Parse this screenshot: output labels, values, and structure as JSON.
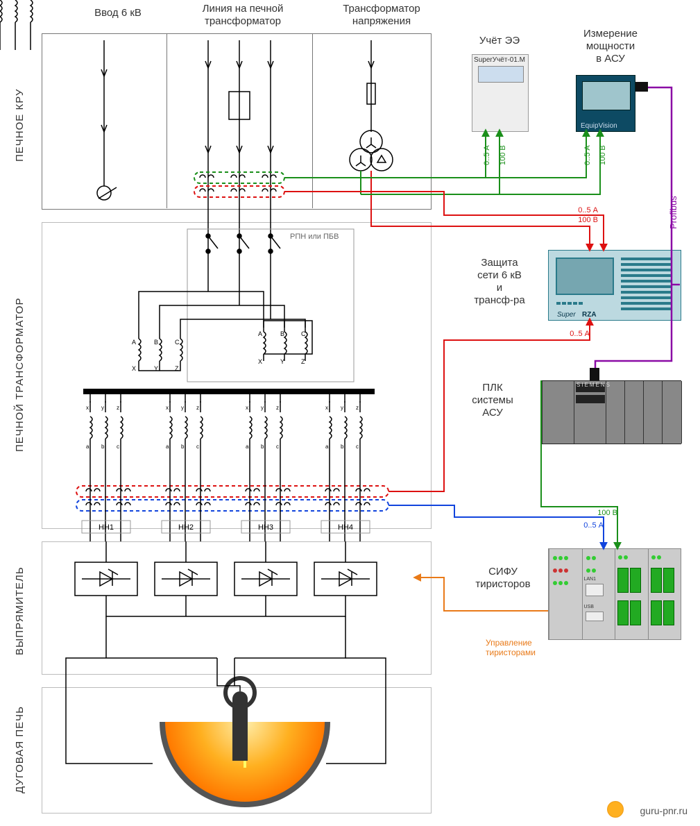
{
  "columns": {
    "input6kv": "Ввод 6 кВ",
    "line_to_ft": "Линия на печной\nтрансформатор",
    "voltage_trans": "Трансформатор\nнапряжения"
  },
  "rows": {
    "kru": "ПЕЧНОЕ КРУ",
    "ft": "ПЕЧНОЙ ТРАНСФОРМАТОР",
    "rect": "ВЫПРЯМИТЕЛЬ",
    "arc": "ДУГОВАЯ ПЕЧЬ"
  },
  "devices": {
    "meter_title": "Учёт ЭЭ",
    "meter_model": "SuperУчёт-01.M",
    "power_title": "Измерение\nмощности\nв АСУ",
    "power_vendor": "EquipVision",
    "rza_title": "Защита\nсети 6 кВ\nи\nтрансф-ра",
    "rza_brand1": "Super",
    "rza_brand2": "RZA",
    "plc_title": "ПЛК\nсистемы\nАСУ",
    "plc_brand": "SIEMENS",
    "sifu_title": "СИФУ\nтиристоров",
    "sifu_port1": "LAN1",
    "sifu_port2": "USB"
  },
  "signals": {
    "meter_amp": "0..5 А",
    "meter_volt": "100 В",
    "power_amp": "0..5 А",
    "power_volt": "100 В",
    "rza1_amp": "0..5 А",
    "rza1_volt": "100 В",
    "rza2_amp": "0..5 А",
    "sifu_volt": "100 В",
    "sifu_amp": "0..5 А",
    "profibus": "Profibus",
    "thyristor_ctrl": "Управление\nтиристорами"
  },
  "ft": {
    "rpn_note": "РПН или ПБВ",
    "prim_A": "A",
    "prim_B": "B",
    "prim_C": "C",
    "prim_X": "X",
    "prim_Y": "Y",
    "prim_Z": "Z",
    "sec_a": "a",
    "sec_b": "b",
    "sec_c": "c",
    "sec_x": "x",
    "sec_y": "y",
    "sec_z": "z",
    "nn1": "НН1",
    "nn2": "НН2",
    "nn3": "НН3",
    "nn4": "НН4"
  },
  "footer": "guru-pnr.ru"
}
